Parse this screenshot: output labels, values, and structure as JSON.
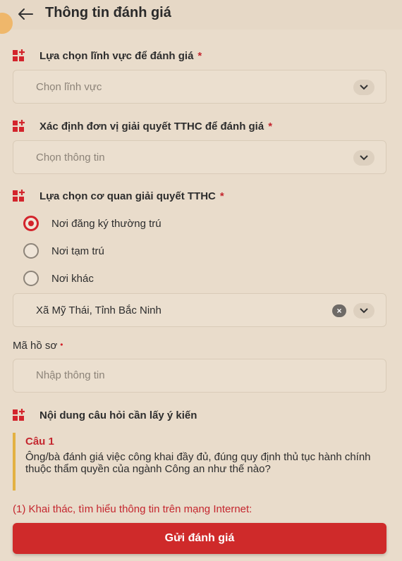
{
  "header": {
    "title": "Thông tin đánh giá"
  },
  "sections": {
    "field": {
      "title": "Lựa chọn lĩnh vực để đánh giá",
      "required": "*",
      "placeholder": "Chọn lĩnh vực"
    },
    "unit": {
      "title": "Xác định đơn vị giải quyết TTHC để đánh giá",
      "required": "*",
      "placeholder": "Chọn thông tin"
    },
    "agency": {
      "title": "Lựa chọn cơ quan giải quyết TTHC",
      "required": "*",
      "options": [
        "Nơi đăng ký thường trú",
        "Nơi tạm trú",
        "Nơi khác"
      ],
      "selected_index": 0,
      "location_value": "Xã Mỹ Thái, Tỉnh Bắc Ninh"
    },
    "record": {
      "label": "Mã hồ sơ",
      "required": "•",
      "placeholder": "Nhập thông tin"
    },
    "questions": {
      "title": "Nội dung câu hỏi cần lấy ý kiến"
    }
  },
  "question": {
    "number": "Câu 1",
    "text": "Ông/bà đánh giá việc công khai đầy đủ, đúng quy định thủ tục hành chính thuộc thẩm quyền của ngành Công an như thế nào?",
    "option_1": "(1) Khai thác, tìm hiểu thông tin trên mạng Internet:"
  },
  "submit_label": "Gửi đánh giá",
  "colors": {
    "accent": "#d3242c",
    "background": "#e9dccb",
    "question_bar": "#e3b142"
  }
}
